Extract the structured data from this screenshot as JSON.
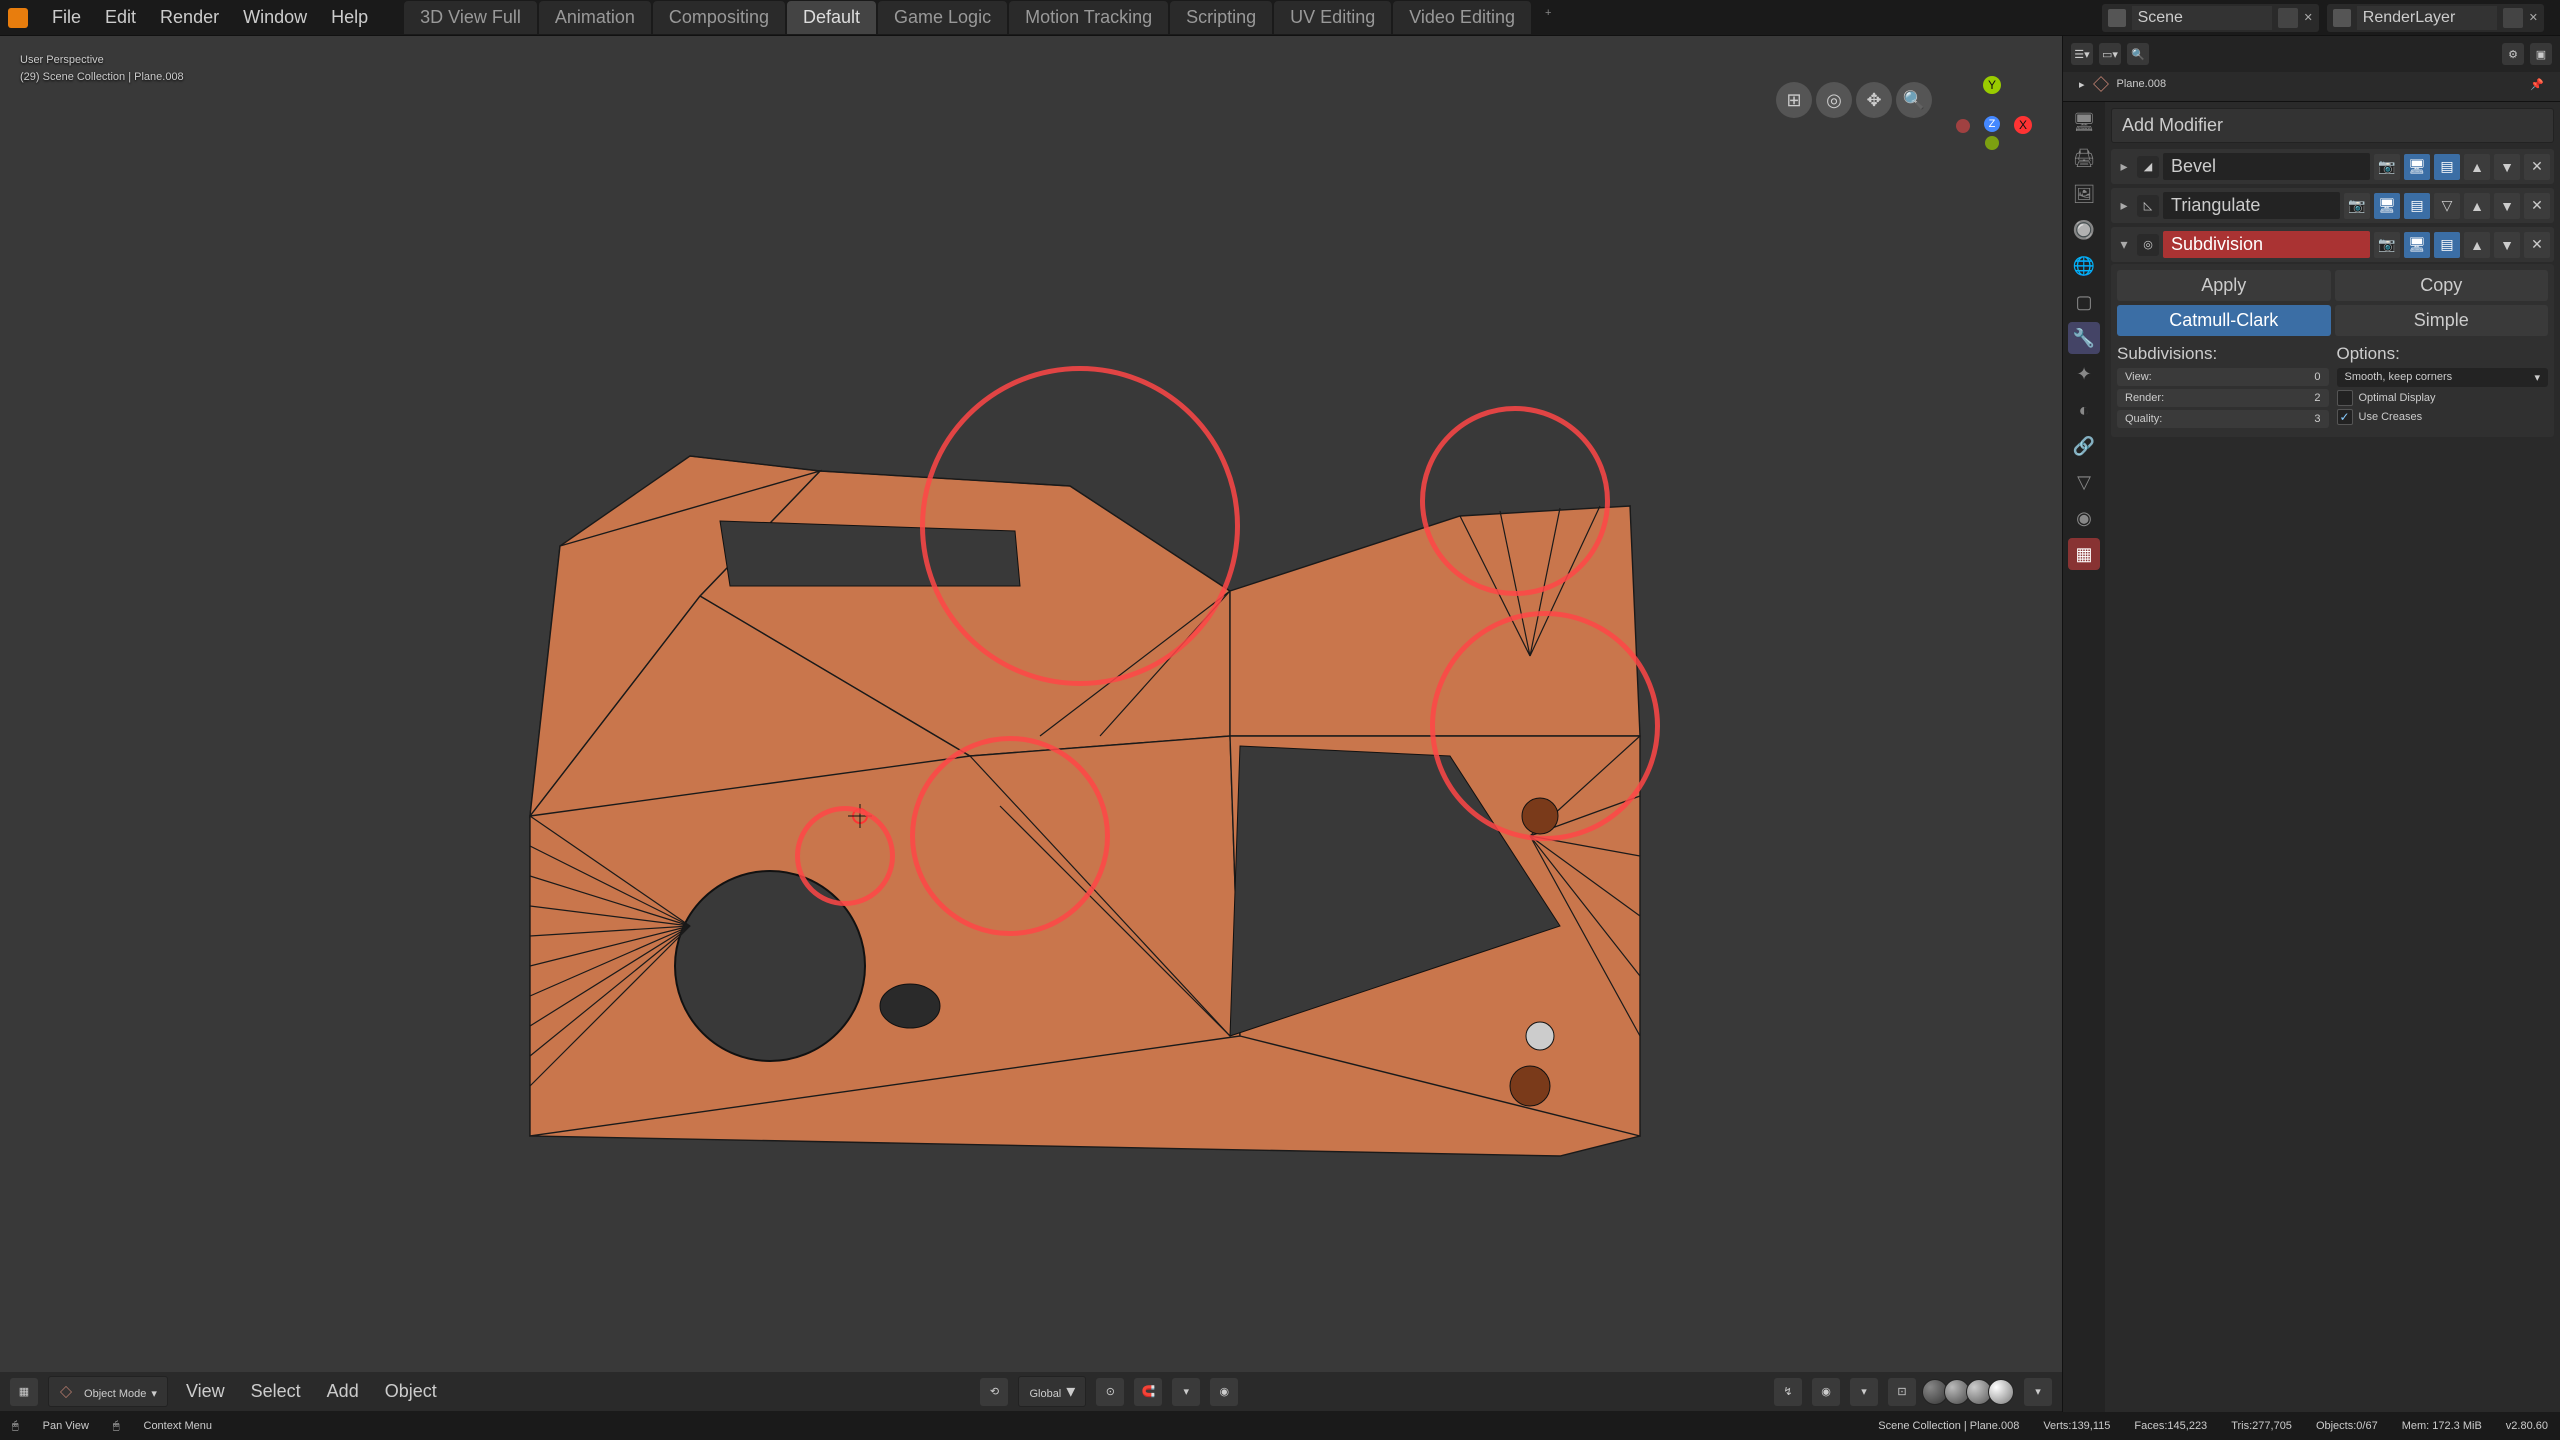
{
  "menu": {
    "file": "File",
    "edit": "Edit",
    "render": "Render",
    "window": "Window",
    "help": "Help"
  },
  "workspace_tabs": [
    "3D View Full",
    "Animation",
    "Compositing",
    "Default",
    "Game Logic",
    "Motion Tracking",
    "Scripting",
    "UV Editing",
    "Video Editing"
  ],
  "workspace_active": 3,
  "scene_name": "Scene",
  "renderlayer_name": "RenderLayer",
  "viewport": {
    "persp_label": "User Perspective",
    "collection_label": "(29) Scene Collection | Plane.008"
  },
  "vp_header": {
    "mode": "Object Mode",
    "view": "View",
    "select": "Select",
    "add": "Add",
    "object": "Object",
    "orientation": "Global"
  },
  "outliner": {
    "search_placeholder": "",
    "active_obj": "Plane.008"
  },
  "add_modifier_label": "Add Modifier",
  "modifiers": [
    {
      "name": "Bevel",
      "expanded": false,
      "highlighted": false
    },
    {
      "name": "Triangulate",
      "expanded": false,
      "highlighted": false
    },
    {
      "name": "Subdivision",
      "expanded": true,
      "highlighted": true
    }
  ],
  "subsurf": {
    "apply": "Apply",
    "copy": "Copy",
    "type_a": "Catmull-Clark",
    "type_b": "Simple",
    "subdivisions_label": "Subdivisions:",
    "view_label": "View:",
    "view_val": "0",
    "render_label": "Render:",
    "render_val": "2",
    "quality_label": "Quality:",
    "quality_val": "3",
    "options_label": "Options:",
    "uv_smooth": "Smooth, keep corners",
    "optimal": "Optimal Display",
    "creases": "Use Creases"
  },
  "status": {
    "left1": "Pan View",
    "left2": "Context Menu",
    "path": "Scene Collection | Plane.008",
    "verts": "Verts:139,115",
    "faces": "Faces:145,223",
    "tris": "Tris:277,705",
    "objects": "Objects:0/67",
    "mem": "Mem: 172.3 MiB",
    "ver": "v2.80.60"
  }
}
